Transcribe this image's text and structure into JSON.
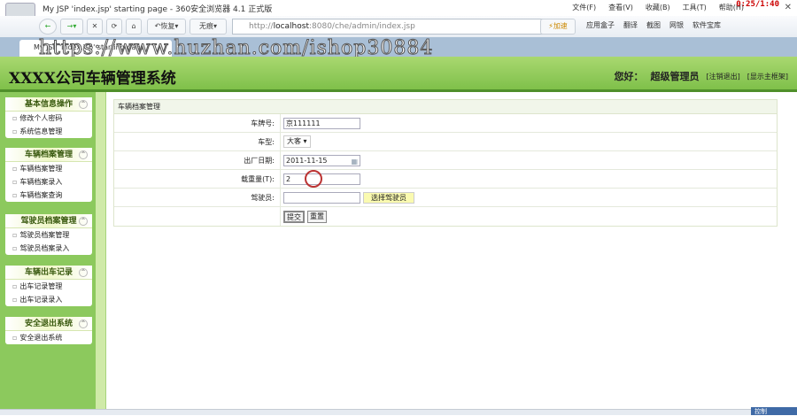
{
  "browser": {
    "title": "My JSP 'index.jsp' starting page - 360安全浏览器 4.1 正式版",
    "menus": [
      "文件(F)",
      "查看(V)",
      "收藏(B)",
      "工具(T)",
      "帮助(H)"
    ],
    "timer": "0:25/1:40",
    "restore": "恢复",
    "incognito": "无痕",
    "url_prefix": "http://",
    "url_host": "localhost",
    "url_rest": ":8080/che/admin/index.jsp",
    "accelerate": "加速",
    "tools": [
      "应用盒子",
      "翻译",
      "截图",
      "网银",
      "软件宝库"
    ],
    "tab": "My JSP 'index.jsp' starting page",
    "watermark": "https://www.huzhan.com/ishop30884",
    "ctrl": "控制"
  },
  "header": {
    "title": "XXXX公司车辆管理系统",
    "greeting": "您好：",
    "user": "超级管理员",
    "logout": "[注销退出]",
    "show_frame": "[显示主框架]"
  },
  "sidebar": [
    {
      "title": "基本信息操作",
      "items": [
        "修改个人密码",
        "系统信息管理"
      ]
    },
    {
      "title": "车辆档案管理",
      "items": [
        "车辆档案管理",
        "车辆档案录入",
        "车辆档案查询"
      ]
    },
    {
      "title": "驾驶员档案管理",
      "items": [
        "驾驶员档案管理",
        "驾驶员档案录入"
      ]
    },
    {
      "title": "车辆出车记录",
      "items": [
        "出车记录管理",
        "出车记录录入"
      ]
    },
    {
      "title": "安全退出系统",
      "items": [
        "安全退出系统"
      ]
    }
  ],
  "form": {
    "title": "车辆档案管理",
    "plate_label": "车牌号:",
    "plate": "京111111",
    "type_label": "车型:",
    "type": "大客",
    "date_label": "出厂日期:",
    "date": "2011-11-15",
    "load_label": "载重量(T):",
    "load": "2",
    "driver_label": "驾驶员:",
    "driver": "",
    "choose_driver": "选择驾驶员",
    "submit": "提交",
    "reset": "重置"
  }
}
